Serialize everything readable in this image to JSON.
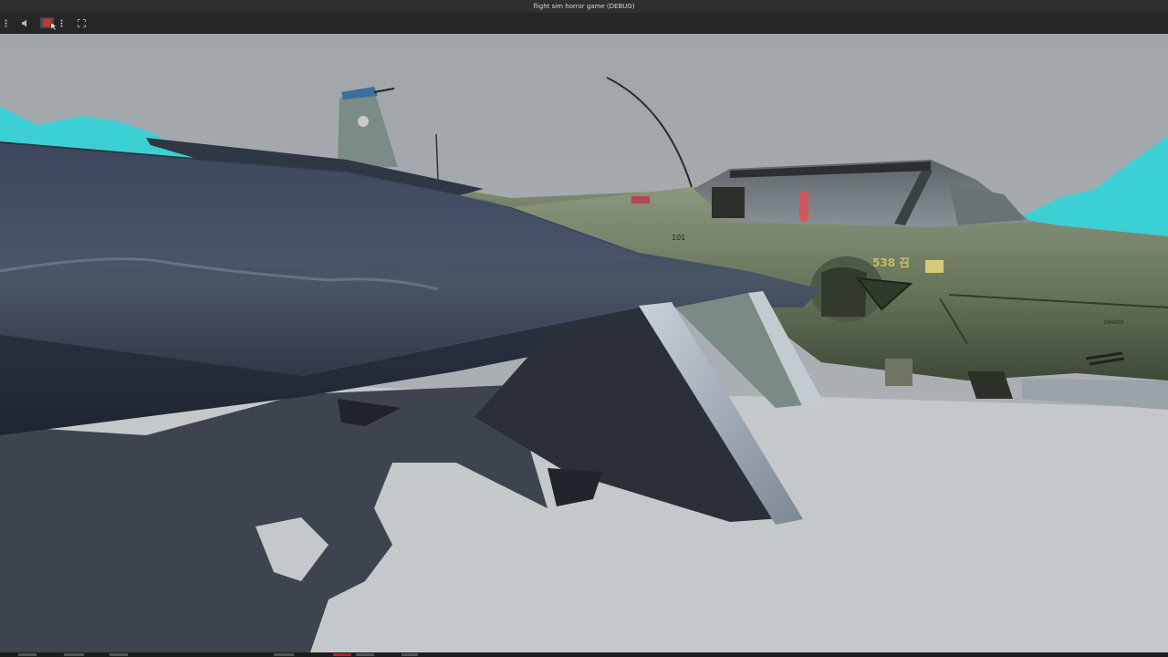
{
  "window": {
    "title": "flight sim horror game (DEBUG)"
  },
  "toolbar": {
    "items": [
      {
        "name": "menu-dots-icon",
        "icon": "vertical-dots"
      },
      {
        "name": "audio-icon",
        "icon": "speaker"
      },
      {
        "name": "record-icon",
        "icon": "record",
        "active_color": "#c0392b"
      },
      {
        "name": "options-dots-icon",
        "icon": "vertical-dots"
      },
      {
        "name": "fullscreen-icon",
        "icon": "expand"
      }
    ]
  },
  "scene": {
    "description_icon": "fighter-jet-3d-render",
    "aircraft_markings": {
      "nose_number": "101",
      "fuselage_code": "538 召",
      "panel_text": "DANGER"
    },
    "colors": {
      "sky": "#a4a9ae",
      "ground": "#c5c9cc",
      "mountains": "#3fd1d6",
      "fuselage": "#6c7a63",
      "wing": "#3c4659"
    }
  }
}
